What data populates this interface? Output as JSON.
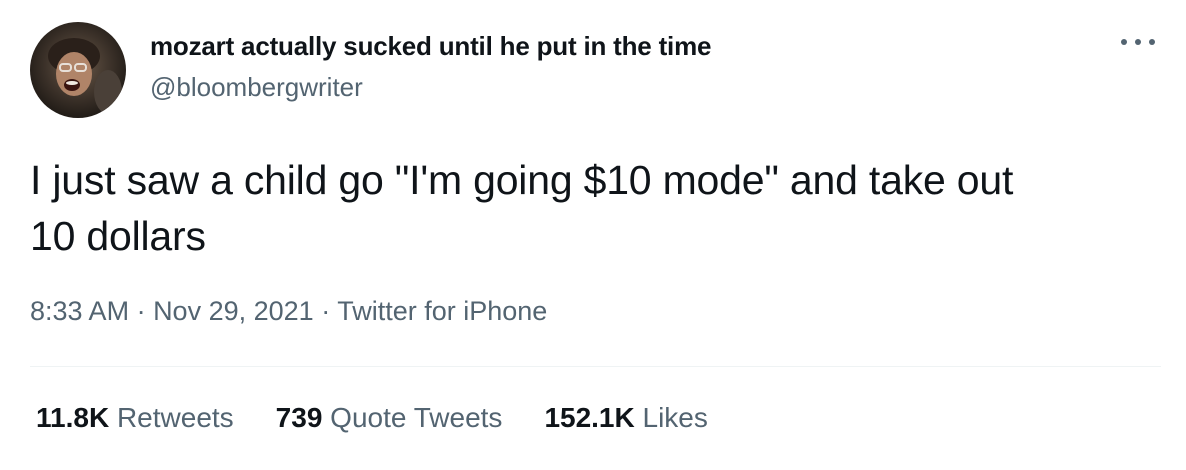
{
  "tweet": {
    "author": {
      "display_name": "mozart actually sucked until he put in the time",
      "handle": "@bloombergwriter"
    },
    "text_line1": "I just saw a child go \"I'm going $10 mode\" and take out",
    "text_line2": "10 dollars",
    "meta": {
      "time": "8:33 AM",
      "sep1": " · ",
      "date": "Nov 29, 2021",
      "sep2": " · ",
      "source": "Twitter for iPhone"
    },
    "stats": {
      "retweets_count": "11.8K",
      "retweets_label": "Retweets",
      "quotes_count": "739",
      "quotes_label": "Quote Tweets",
      "likes_count": "152.1K",
      "likes_label": "Likes"
    }
  },
  "icons": {
    "more": "more-horizontal-icon",
    "avatar": "avatar-image"
  },
  "colors": {
    "text_primary": "#0f1419",
    "text_secondary": "#536471",
    "divider": "#eff3f4"
  }
}
